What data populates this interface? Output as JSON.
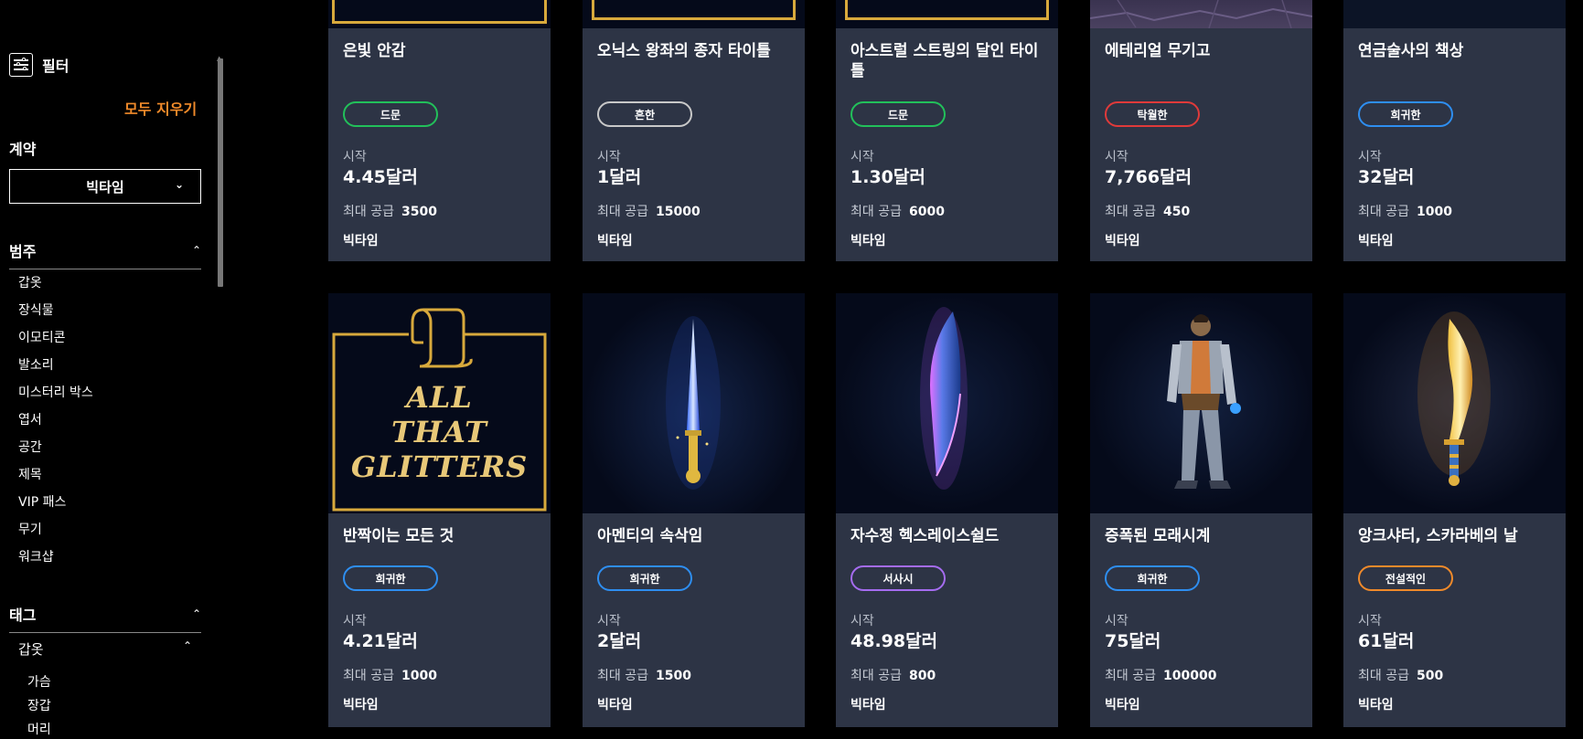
{
  "sidebar": {
    "filter_label": "필터",
    "clear_all": "모두 지우기",
    "contract": {
      "title": "계약",
      "selected": "빅타임"
    },
    "category": {
      "title": "범주",
      "items": [
        "갑옷",
        "장식물",
        "이모티콘",
        "발소리",
        "미스터리 박스",
        "엽서",
        "공간",
        "제목",
        "VIP 패스",
        "무기",
        "워크샵"
      ]
    },
    "tags": {
      "title": "태그",
      "sub_title": "갑옷",
      "items": [
        "가슴",
        "장갑",
        "머리"
      ]
    }
  },
  "labels": {
    "start": "시작",
    "max_supply": "최대 공급"
  },
  "cards": [
    {
      "name": "은빛 안감",
      "rarity": "드문",
      "price": "4.45달러",
      "supply": "3500",
      "brand": "빅타임",
      "color": "#22c05a"
    },
    {
      "name": "오닉스 왕좌의 종자 타이틀",
      "rarity": "흔한",
      "price": "1달러",
      "supply": "15000",
      "brand": "빅타임",
      "color": "#c8c8c8"
    },
    {
      "name": "아스트럴 스트링의 달인 타이틀",
      "rarity": "드문",
      "price": "1.30달러",
      "supply": "6000",
      "brand": "빅타임",
      "color": "#22c05a"
    },
    {
      "name": "에테리얼 무기고",
      "rarity": "탁월한",
      "price": "7,766달러",
      "supply": "450",
      "brand": "빅타임",
      "color": "#e03a3a"
    },
    {
      "name": "연금술사의 책상",
      "rarity": "희귀한",
      "price": "32달러",
      "supply": "1000",
      "brand": "빅타임",
      "color": "#2e8ef0"
    },
    {
      "name": "반짝이는 모든 것",
      "rarity": "희귀한",
      "price": "4.21달러",
      "supply": "1000",
      "brand": "빅타임",
      "color": "#2e8ef0",
      "image_text": [
        "ALL",
        "THAT",
        "GLITTERS"
      ]
    },
    {
      "name": "아멘티의 속삭임",
      "rarity": "희귀한",
      "price": "2달러",
      "supply": "1500",
      "brand": "빅타임",
      "color": "#2e8ef0"
    },
    {
      "name": "자수정 헥스레이스쉴드",
      "rarity": "서사시",
      "price": "48.98달러",
      "supply": "800",
      "brand": "빅타임",
      "color": "#a56cf0"
    },
    {
      "name": "증폭된 모래시계",
      "rarity": "희귀한",
      "price": "75달러",
      "supply": "100000",
      "brand": "빅타임",
      "color": "#2e8ef0"
    },
    {
      "name": "앙크샤터, 스카라베의 날",
      "rarity": "전설적인",
      "price": "61달러",
      "supply": "500",
      "brand": "빅타임",
      "color": "#f08a2a"
    }
  ]
}
